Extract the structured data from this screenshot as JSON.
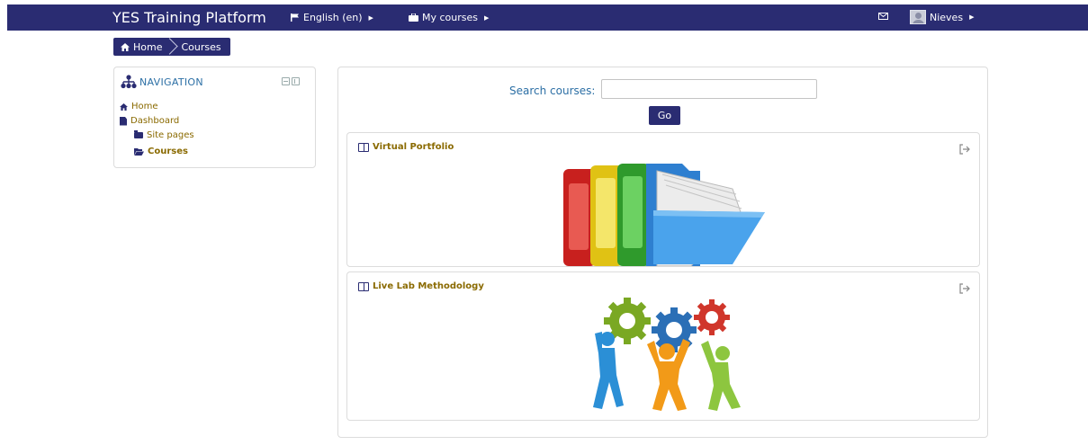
{
  "navbar": {
    "brand": "YES Training Platform",
    "language": "English (en)",
    "my_courses": "My courses",
    "user_name": "Nieves",
    "color": "#2a2c72"
  },
  "breadcrumb": {
    "home": "Home",
    "current": "Courses"
  },
  "navigation_block": {
    "title": "NAVIGATION",
    "items": [
      {
        "label": "Home",
        "icon": "home-icon"
      },
      {
        "label": "Dashboard",
        "icon": "document-icon"
      },
      {
        "label": "Site pages",
        "icon": "folder-icon"
      },
      {
        "label": "Courses",
        "icon": "folder-open-icon",
        "active": true
      }
    ]
  },
  "search": {
    "label": "Search courses:",
    "value": "",
    "button": "Go"
  },
  "courses": [
    {
      "title": "Virtual Portfolio",
      "image": "binders-and-folder-illustration"
    },
    {
      "title": "Live Lab Methodology",
      "image": "people-with-gears-illustration"
    }
  ]
}
